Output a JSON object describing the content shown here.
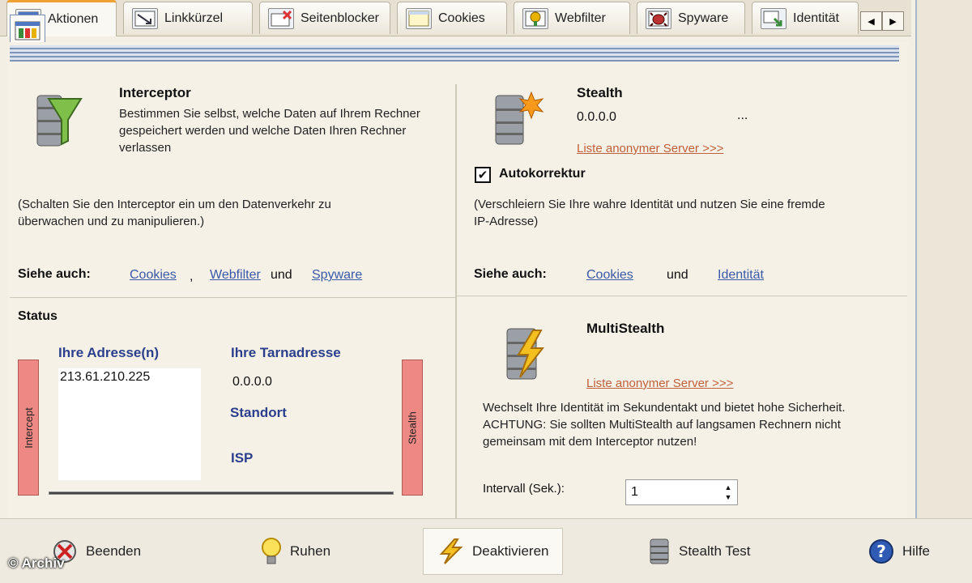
{
  "tabs": [
    {
      "label": "Aktionen",
      "icon": "actions-icon",
      "active": true
    },
    {
      "label": "Linkkürzel",
      "icon": "link-shortcut-icon"
    },
    {
      "label": "Seitenblocker",
      "icon": "page-blocker-icon"
    },
    {
      "label": "Cookies",
      "icon": "cookies-icon"
    },
    {
      "label": "Webfilter",
      "icon": "webfilter-icon"
    },
    {
      "label": "Spyware",
      "icon": "spyware-icon"
    },
    {
      "label": "Identität",
      "icon": "identity-icon"
    }
  ],
  "tab_scroll": {
    "left": "◀",
    "right": "▶"
  },
  "interceptor": {
    "title": "Interceptor",
    "description": "Bestimmen Sie selbst, welche Daten auf Ihrem Rechner gespeichert werden und welche Daten Ihren Rechner verlassen",
    "hint": "(Schalten Sie den Interceptor ein um den Datenverkehr zu überwachen und zu manipulieren.)",
    "see_also_label": "Siehe auch:",
    "link_cookies": "Cookies",
    "sep_comma": ",",
    "link_webfilter": "Webfilter",
    "sep_and": "und",
    "link_spyware": "Spyware"
  },
  "stealth": {
    "title": "Stealth",
    "ip": "0.0.0.0",
    "dots": "...",
    "server_link": "Liste anonymer Server >>>",
    "autocorrect_label": "Autokorrektur",
    "autocorrect_checked": "✔",
    "hint": "(Verschleiern Sie Ihre wahre Identität und nutzen Sie eine fremde IP-Adresse)",
    "see_also_label": "Siehe auch:",
    "link_cookies": "Cookies",
    "sep_and": "und",
    "link_identity": "Identität"
  },
  "status": {
    "title": "Status",
    "your_address_label": "Ihre Adresse(n)",
    "your_address_value": "213.61.210.225",
    "mask_address_label": "Ihre Tarnadresse",
    "mask_address_value": "0.0.0.0",
    "location_label": "Standort",
    "isp_label": "ISP",
    "intercept_bar": "Intercept",
    "stealth_bar": "Stealth"
  },
  "multistealth": {
    "title": "MultiStealth",
    "server_link": "Liste anonymer Server >>>",
    "description": "Wechselt Ihre Identität im Sekundentakt und bietet hohe Sicherheit. ACHTUNG: Sie sollten MultiStealth auf langsamen Rechnern nicht gemeinsam mit dem Interceptor nutzen!",
    "interval_label": "Intervall (Sek.):",
    "interval_value": "1",
    "spin_up": "▲",
    "spin_down": "▼"
  },
  "bottom": {
    "quit": "Beenden",
    "rest": "Ruhen",
    "deactivate": "Deaktivieren",
    "stealth_test": "Stealth Test",
    "help": "Hilfe"
  },
  "watermark": "© Archiv",
  "colors": {
    "accent_tab": "#f0a030",
    "link": "#3a58a8",
    "server_link": "#c0603a",
    "bar": "#ee8884"
  }
}
